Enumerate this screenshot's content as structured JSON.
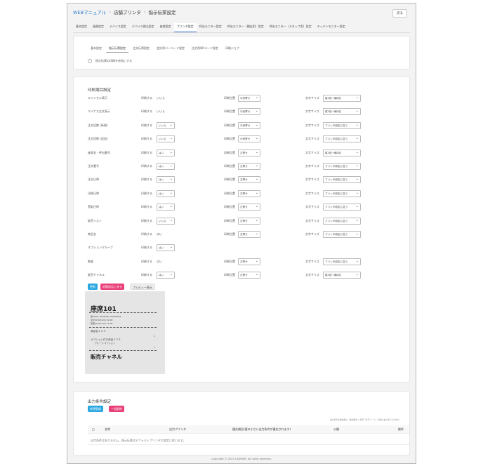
{
  "breadcrumb": [
    "WEBマニュアル",
    "店舗プリンタ",
    "指示伝票設定"
  ],
  "back_label": "戻る",
  "tabs": [
    "基本設定",
    "画像設定",
    "デバイス設定",
    "デバイス割当設定",
    "座席設定",
    "プリンタ設定",
    "呼出モニター設定",
    "呼出モニター（開店用）設定",
    "呼出モニター（スタッフ用）設定",
    "キッチンモニター設定"
  ],
  "active_tab_index": 5,
  "subtabs": [
    "基本設定",
    "指示伝票設定",
    "注文伝票設定",
    "会計用バーコード設定",
    "注文用QRコード設定",
    "印刷ジョブ"
  ],
  "active_subtab_index": 1,
  "enable_label": "指示伝票の印刷を有効にする",
  "section_title": "印刷項目設定",
  "labels": {
    "print": "印刷する",
    "position": "印刷位置",
    "size": "文字サイズ"
  },
  "rows": [
    {
      "name": "キャンセル表示",
      "print": "いいえ",
      "print_sel": false,
      "position": "中央寄せ",
      "size": "縦2倍＋横2倍"
    },
    {
      "name": "マイナス注文表示",
      "print": "いいえ",
      "print_sel": false,
      "position": "中央寄せ",
      "size": "縦2倍＋横2倍"
    },
    {
      "name": "注文回数 (新規)",
      "print": "いいえ",
      "print_sel": true,
      "position": "中央寄せ",
      "size": "プリンタ設定に従う"
    },
    {
      "name": "注文回数 (追加)",
      "print": "いいえ",
      "print_sel": true,
      "position": "中央寄せ",
      "size": "プリンタ設定に従う"
    },
    {
      "name": "座席名・呼出番号",
      "print": "はい",
      "print_sel": true,
      "position": "左寄せ",
      "size": "縦2倍＋横2倍"
    },
    {
      "name": "注文番号",
      "print": "はい",
      "print_sel": true,
      "position": "左寄せ",
      "size": "プリンタ設定に従う"
    },
    {
      "name": "注文日時",
      "print": "はい",
      "print_sel": true,
      "position": "左寄せ",
      "size": "プリンタ設定に従う"
    },
    {
      "name": "印刷日時",
      "print": "はい",
      "print_sel": true,
      "position": "左寄せ",
      "size": "プリンタ設定に従う"
    },
    {
      "name": "受取日時",
      "print": "はい",
      "print_sel": true,
      "position": "左寄せ",
      "size": "プリンタ設定に従う"
    },
    {
      "name": "販売リスト",
      "print": "いいえ",
      "print_sel": true,
      "position": "左寄せ",
      "size": "プリンタ設定に従う"
    },
    {
      "name": "商品名",
      "print": "はい",
      "print_sel": false,
      "position": "左寄せ",
      "size": "プリンタ設定に従う"
    },
    {
      "name": "オプショングループ",
      "print": "はい",
      "print_sel": true,
      "position": "",
      "size": ""
    },
    {
      "name": "数量",
      "print": "はい",
      "print_sel": false,
      "position": "左寄せ",
      "size": "プリンタ設定に従う"
    },
    {
      "name": "販売チャネル",
      "print": "はい",
      "print_sel": true,
      "position": "左寄せ",
      "size": "縦2倍＋横2倍"
    }
  ],
  "buttons": {
    "update": "更新",
    "reset": "初期設定に戻す",
    "preview": "プレビュー表示"
  },
  "preview": {
    "title": "座席101",
    "lines": [
      "第7000−2020/08−00000001",
      "注文(01/01/01)  12:00",
      "受取(01/01/01)  12:30"
    ],
    "item": "商品名１２３",
    "qty": "1",
    "option_item": "オプション付き商品１２３",
    "option_group": "グループ: オプション",
    "qty2": "1",
    "channel": "販売チャネル"
  },
  "output": {
    "title": "出力条件設定",
    "new_label": "新規登録",
    "delete_label": "一括削除",
    "note": "出力条件の優先順は、優先順位 1 名称「文字ソート」の順に並び替えられます。",
    "columns": [
      "名称",
      "出力プリンタ",
      "優先順位(値の小さい出力条件が優先されます)",
      "公開",
      "操作"
    ],
    "empty": "出力条件はありません。指示伝票はデフォルトプリンタの設定に従います。"
  },
  "footer": "Copyright © 2025 CASHIER. All rights reserved.",
  "colors": {
    "link": "#2a7ac9",
    "btn_blue": "#2aa7e0",
    "btn_pink": "#e8407a"
  }
}
